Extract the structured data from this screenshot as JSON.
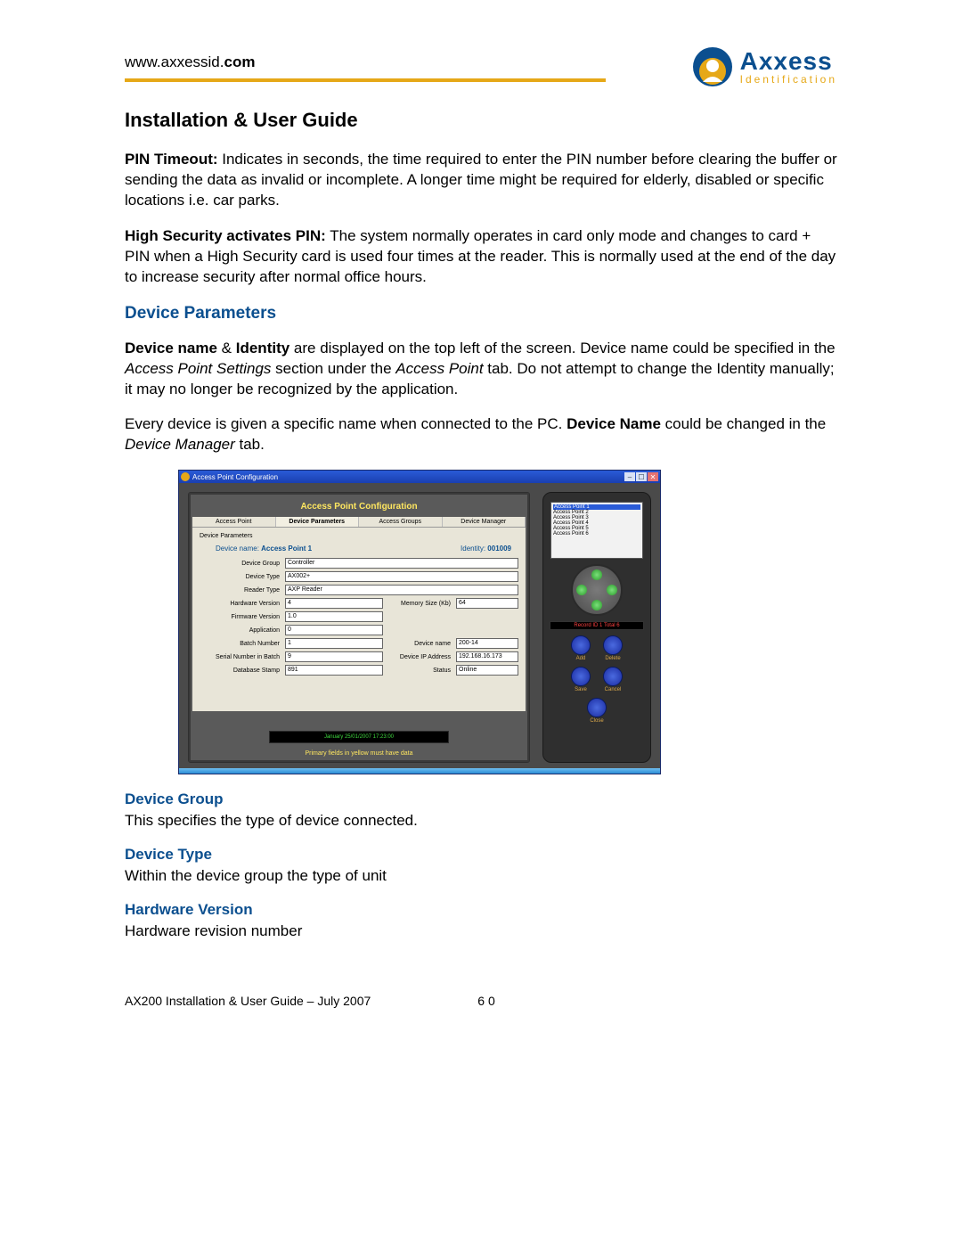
{
  "header": {
    "url_plain": "www.axxessid.",
    "url_bold": "com",
    "logo_top": "Axxess",
    "logo_bottom": "Identification"
  },
  "title": "Installation & User Guide",
  "para1": {
    "bold": "PIN Timeout:",
    "text": " Indicates in seconds, the time required to enter the PIN number before clearing the buffer or sending the data as invalid or incomplete. A longer time might be required for elderly, disabled or specific locations i.e. car parks."
  },
  "para2": {
    "bold": "High Security activates PIN:",
    "text": " The system normally operates in card only mode and changes to card + PIN when a High Security card is used four times at the reader. This is normally used at the end of the day to increase security after normal office hours."
  },
  "section_heading": "Device Parameters",
  "para3_a": "Device name",
  "para3_amp": " & ",
  "para3_b": "Identity",
  "para3_c": " are displayed on the top left of the screen. Device name could be specified in the ",
  "para3_i1": "Access Point Settings",
  "para3_d": " section under the ",
  "para3_i2": "Access Point",
  "para3_e": " tab. Do not attempt to change the Identity manually; it may no longer be recognized by the application.",
  "para4_a": "Every device is given a specific name when connected to the PC. ",
  "para4_bold": "Device Name",
  "para4_b": " could be changed in the ",
  "para4_i": "Device Manager",
  "para4_c": " tab.",
  "app": {
    "title": "Access Point Configuration",
    "config_title": "Access Point Configuration",
    "tabs": [
      "Access Point",
      "Device Parameters",
      "Access Groups",
      "Device Manager"
    ],
    "fieldset": "Device Parameters",
    "device_name_label": "Device name:",
    "device_name_value": "Access Point 1",
    "identity_label": "Identity:",
    "identity_value": "001009",
    "fields": {
      "device_group_label": "Device Group",
      "device_group": "Controller",
      "device_type_label": "Device Type",
      "device_type": "AX002+",
      "reader_type_label": "Reader Type",
      "reader_type": "AXP Reader",
      "hardware_version_label": "Hardware Version",
      "hardware_version": "4",
      "memory_size_label": "Memory Size (Kb)",
      "memory_size": "64",
      "firmware_version_label": "Firmware Version",
      "firmware_version": "1.0",
      "application_label": "Application",
      "application": "0",
      "batch_number_label": "Batch Number",
      "batch_number": "1",
      "device_name2_label": "Device name",
      "device_name2": "200-14",
      "serial_label": "Serial Number in Batch",
      "serial": "9",
      "ip_label": "Device IP Address",
      "ip": "192.168.16.173",
      "db_stamp_label": "Database Stamp",
      "db_stamp": "891",
      "status_label": "Status",
      "status": "Online"
    },
    "date_strip": "January   25/01/2007 17:23:00",
    "hint": "Primary fields in yellow must have data",
    "lcd": {
      "items": [
        "Access Point 1",
        "Access Point 2",
        "Access Point 3",
        "Access Point 4",
        "Access Point 5",
        "Access Point 6"
      ]
    },
    "rec_strip": "Record ID 1 Total 6",
    "buttons": {
      "add": "Add",
      "delete": "Delete",
      "save": "Save",
      "cancel": "Cancel",
      "close": "Close"
    }
  },
  "subs": {
    "dg_h": "Device Group",
    "dg_t": "This specifies the type of device connected.",
    "dt_h": "Device Type",
    "dt_t": "Within the device group the type of unit",
    "hv_h": "Hardware Version",
    "hv_t": "Hardware revision number"
  },
  "footer": {
    "left": "AX200 Installation & User Guide – July 2007",
    "page": "6 0"
  }
}
